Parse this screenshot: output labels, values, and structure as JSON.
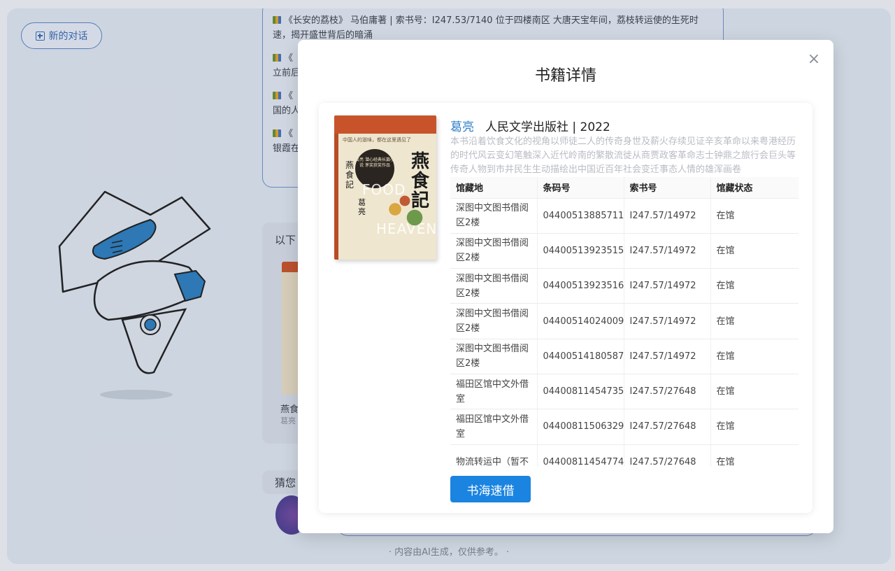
{
  "background": {
    "new_chat_label": "新的对话",
    "messages": [
      {
        "text": "《长安的荔枝》 马伯庸著 | 索书号：I247.53/7140 位于四楼南区 大唐天宝年间，荔枝转运使的生死时速，揭开盛世背后的暗涌"
      },
      {
        "text": "《"
      },
      {
        "text": "《"
      },
      {
        "text": "《"
      }
    ],
    "message_tails": [
      "立前后",
      "国的人",
      "银霞在"
    ],
    "reco_title": "以下",
    "reco_book_name": "燕食",
    "reco_book_author": "葛亮",
    "guess_label": "猜您",
    "footer_note": "· 内容由AI生成，仅供参考。 ·"
  },
  "modal": {
    "title": "书籍详情",
    "close_symbol": "×",
    "book": {
      "author": "葛亮",
      "publisher_year": "人民文学出版社 | 2022",
      "summary": "本书沿着饮食文化的视角以师徒二人的传奇身世及薪火存续见证辛亥革命以来粤港经历的时代风云变幻笔触深入近代岭南的繁散流徙从商贾政客革命志士钟鼎之旅行会巨头等传奇人物到市井民生生动描绘出中国近百年社会变迁事态人情的雄浑画卷",
      "cover": {
        "title": "燕食記",
        "vertical_title": "燕食記",
        "author": "葛亮",
        "english": "FOOD",
        "english2": "HEAVEN",
        "slogan": "中国人的滋味，都在这里遇见了",
        "badge": "葛亮 潜心经典长篇小说 茅奖获奖作品"
      }
    },
    "table": {
      "headers": [
        "馆藏地",
        "条码号",
        "索书号",
        "馆藏状态"
      ],
      "rows": [
        [
          "深图中文图书借阅区2楼",
          "04400513885711",
          "I247.57/14972",
          "在馆"
        ],
        [
          "深图中文图书借阅区2楼",
          "04400513923515",
          "I247.57/14972",
          "在馆"
        ],
        [
          "深图中文图书借阅区2楼",
          "04400513923516",
          "I247.57/14972",
          "在馆"
        ],
        [
          "深图中文图书借阅区2楼",
          "04400514024009",
          "I247.57/14972",
          "在馆"
        ],
        [
          "深图中文图书借阅区2楼",
          "04400514180587",
          "I247.57/14972",
          "在馆"
        ],
        [
          "福田区馆中文外借室",
          "04400811454735",
          "I247.57/27648",
          "在馆"
        ],
        [
          "福田区馆中文外借室",
          "04400811506329",
          "I247.57/27648",
          "在馆"
        ],
        [
          "物流转运中（暂不",
          "04400811454774",
          "I247.57/27648",
          "在馆"
        ]
      ]
    },
    "borrow_button": "书海速借"
  }
}
